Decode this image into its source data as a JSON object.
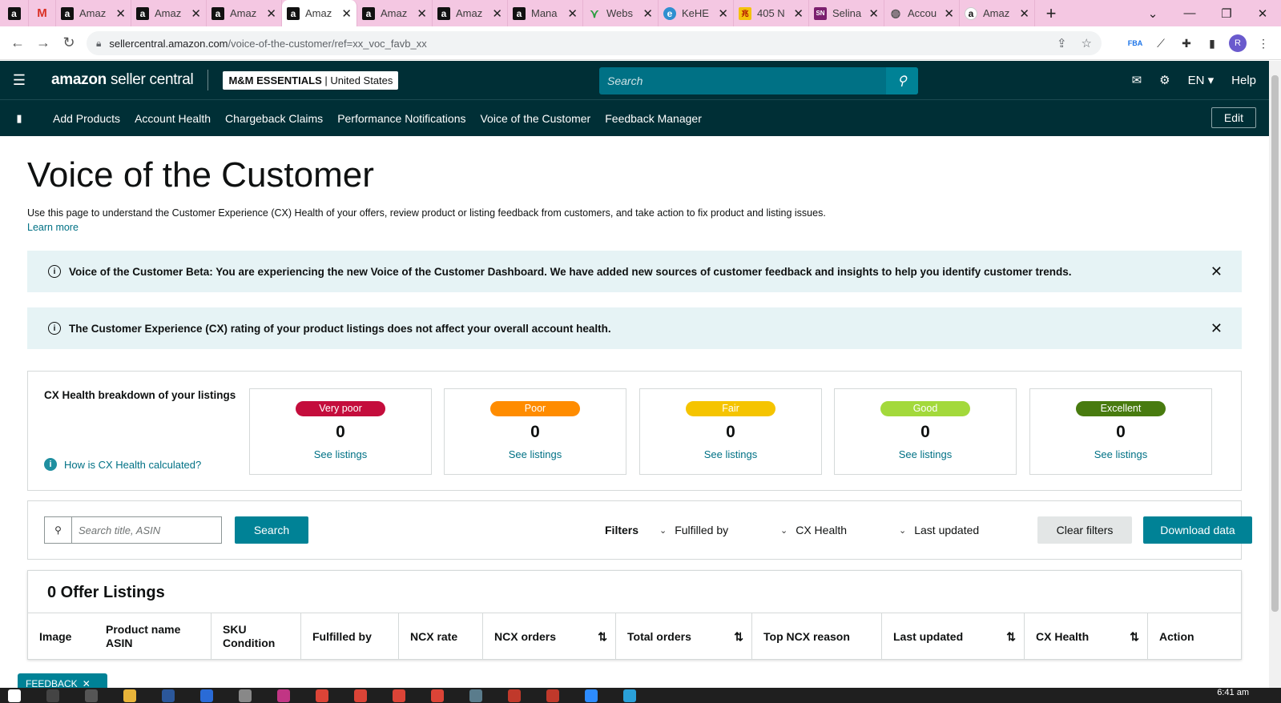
{
  "browser": {
    "tabs": [
      {
        "icon": "amazon-icon",
        "title": ""
      },
      {
        "icon": "gmail-icon",
        "title": ""
      },
      {
        "icon": "amazon-icon",
        "title": "Amaz"
      },
      {
        "icon": "amazon-icon",
        "title": "Amaz"
      },
      {
        "icon": "amazon-icon",
        "title": "Amaz"
      },
      {
        "icon": "amazon-icon",
        "title": "Amaz"
      },
      {
        "icon": "amazon-icon",
        "title": "Amaz"
      },
      {
        "icon": "amazon-icon",
        "title": "Amaz"
      },
      {
        "icon": "amazon-icon",
        "title": "Mana"
      },
      {
        "icon": "webs-icon",
        "title": "Webs"
      },
      {
        "icon": "kehe-icon",
        "title": "KeHE"
      },
      {
        "icon": "405-icon",
        "title": "405 N"
      },
      {
        "icon": "sn-icon",
        "title": "Selina"
      },
      {
        "icon": "globe-icon",
        "title": "Accou"
      },
      {
        "icon": "amazon-icon",
        "title": "Amaz"
      }
    ],
    "active_tab_index": 5,
    "url_host": "sellercentral.amazon.com",
    "url_path": "/voice-of-the-customer/ref=xx_voc_favb_xx",
    "avatar_letter": "R"
  },
  "header": {
    "logo_bold": "amazon",
    "logo_sub": "seller central",
    "store_name": "M&M ESSENTIALS",
    "store_region": "United States",
    "search_placeholder": "Search",
    "language": "EN",
    "help": "Help"
  },
  "nav": {
    "items": [
      "Add Products",
      "Account Health",
      "Chargeback Claims",
      "Performance Notifications",
      "Voice of the Customer",
      "Feedback Manager"
    ],
    "edit": "Edit"
  },
  "page": {
    "title": "Voice of the Customer",
    "description": "Use this page to understand the Customer Experience (CX) Health of your offers, review product or listing feedback from customers, and take action to fix product and listing issues.",
    "learn_more": "Learn more"
  },
  "alerts": [
    "Voice of the Customer Beta: You are experiencing the new Voice of the Customer Dashboard. We have added new sources of customer feedback and insights to help you identify customer trends.",
    "The Customer Experience (CX) rating of your product listings does not affect your overall account health."
  ],
  "cx_health": {
    "label": "CX Health breakdown of your listings",
    "help_link": "How is CX Health calculated?",
    "cards": [
      {
        "label": "Very poor",
        "count": "0",
        "link": "See listings",
        "color": "#c40d3c"
      },
      {
        "label": "Poor",
        "count": "0",
        "link": "See listings",
        "color": "#ff8c00"
      },
      {
        "label": "Fair",
        "count": "0",
        "link": "See listings",
        "color": "#f5c400"
      },
      {
        "label": "Good",
        "count": "0",
        "link": "See listings",
        "color": "#a3d93b"
      },
      {
        "label": "Excellent",
        "count": "0",
        "link": "See listings",
        "color": "#487b0f"
      }
    ]
  },
  "filters": {
    "search_placeholder": "Search title, ASIN",
    "search_button": "Search",
    "label": "Filters",
    "dropdowns": [
      "Fulfilled by",
      "CX Health",
      "Last updated"
    ],
    "clear": "Clear filters",
    "download": "Download data"
  },
  "listings": {
    "title": "0 Offer Listings",
    "columns": [
      {
        "line1": "Image",
        "line2": ""
      },
      {
        "line1": "Product name",
        "line2": "ASIN"
      },
      {
        "line1": "SKU",
        "line2": "Condition"
      },
      {
        "line1": "Fulfilled by",
        "line2": ""
      },
      {
        "line1": "NCX rate",
        "line2": ""
      },
      {
        "line1": "NCX orders",
        "line2": ""
      },
      {
        "line1": "Total orders",
        "line2": ""
      },
      {
        "line1": "Top NCX reason",
        "line2": ""
      },
      {
        "line1": "Last updated",
        "line2": ""
      },
      {
        "line1": "CX Health",
        "line2": ""
      },
      {
        "line1": "Action",
        "line2": ""
      }
    ]
  },
  "feedback_tab": "FEEDBACK",
  "taskbar": {
    "time": "6:41 am"
  }
}
